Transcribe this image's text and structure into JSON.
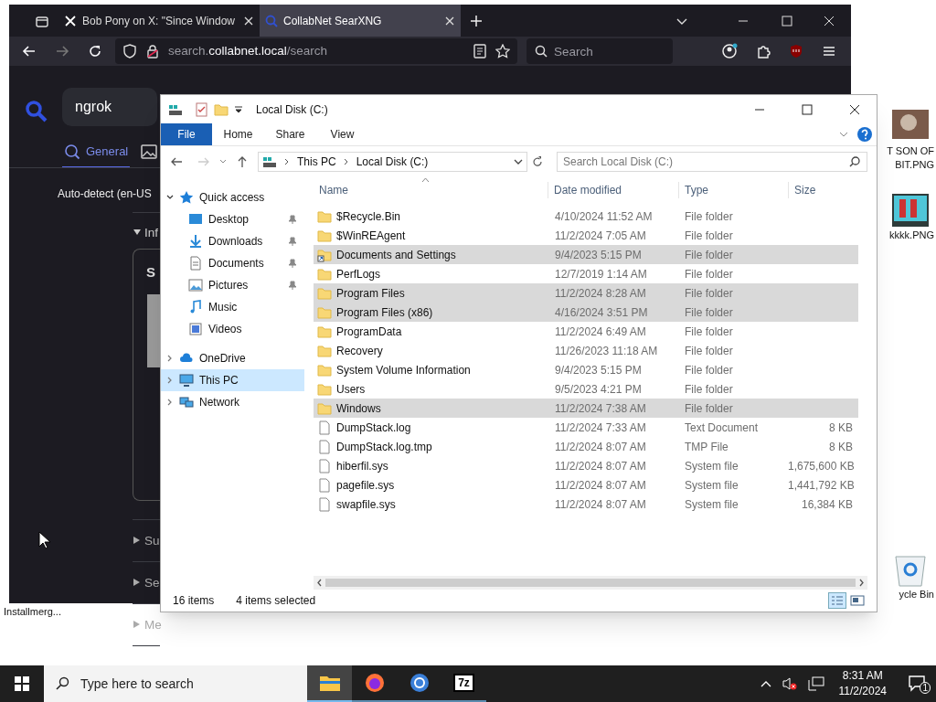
{
  "desktop": {
    "icons": [
      {
        "kind": "photo",
        "label_lines": [
          "T SON OF",
          "BIT.PNG"
        ]
      },
      {
        "kind": "image",
        "label_lines": [
          "kkkk.PNG"
        ]
      },
      {
        "kind": "recycle",
        "label_lines": [
          "ycle Bin"
        ]
      }
    ],
    "left_label": "Installmerg..."
  },
  "browser": {
    "tabs": [
      {
        "label": "Bob Pony on X: \"Since Window",
        "selected": false,
        "kind": "x"
      },
      {
        "label": "CollabNet SearXNG",
        "selected": true,
        "kind": "searx"
      }
    ],
    "url": {
      "subdomain": "search.",
      "domain": "collabnet.local",
      "path": "/search"
    },
    "search": {
      "placeholder": "Search"
    },
    "page": {
      "query": "ngrok",
      "categories": [
        {
          "label": "General",
          "selected": true,
          "kind": "search"
        },
        {
          "selected": false,
          "kind": "image"
        }
      ],
      "language": "Auto-detect (en-US",
      "infobox": {
        "toggle": "Inf",
        "heading": "S"
      },
      "sections": [
        "Su",
        "Se",
        "Me"
      ]
    }
  },
  "explorer": {
    "title": "Local Disk (C:)",
    "ribbon_tabs": [
      {
        "label": "File",
        "selected": true
      },
      {
        "label": "Home",
        "selected": false
      },
      {
        "label": "Share",
        "selected": false
      },
      {
        "label": "View",
        "selected": false
      }
    ],
    "breadcrumb": [
      "This PC",
      "Local Disk (C:)"
    ],
    "search": {
      "placeholder": "Search Local Disk (C:)"
    },
    "nav": [
      {
        "label": "Quick access",
        "kind": "star",
        "expanded": true,
        "selected": false,
        "children": [
          {
            "label": "Desktop",
            "kind": "desktop",
            "pinned": true
          },
          {
            "label": "Downloads",
            "kind": "download",
            "pinned": true
          },
          {
            "label": "Documents",
            "kind": "documents",
            "pinned": true
          },
          {
            "label": "Pictures",
            "kind": "pictures",
            "pinned": true
          },
          {
            "label": "Music",
            "kind": "music",
            "pinned": false
          },
          {
            "label": "Videos",
            "kind": "videos",
            "pinned": false
          }
        ]
      },
      {
        "label": "OneDrive",
        "kind": "cloud",
        "expanded": false,
        "selected": false
      },
      {
        "label": "This PC",
        "kind": "pc",
        "expanded": false,
        "selected": true
      },
      {
        "label": "Network",
        "kind": "network",
        "expanded": false,
        "selected": false
      }
    ],
    "columns": [
      "Name",
      "Date modified",
      "Type",
      "Size"
    ],
    "rows": [
      {
        "kind": "folder",
        "name": "$Recycle.Bin",
        "date": "4/10/2024 11:52 AM",
        "type": "File folder",
        "selected": false
      },
      {
        "kind": "folder",
        "name": "$WinREAgent",
        "date": "11/2/2024 7:05 AM",
        "type": "File folder",
        "selected": false
      },
      {
        "kind": "shortcut",
        "name": "Documents and Settings",
        "date": "9/4/2023 5:15 PM",
        "type": "File folder",
        "selected": true
      },
      {
        "kind": "folder",
        "name": "PerfLogs",
        "date": "12/7/2019 1:14 AM",
        "type": "File folder",
        "selected": false
      },
      {
        "kind": "folder",
        "name": "Program Files",
        "date": "11/2/2024 8:28 AM",
        "type": "File folder",
        "selected": true
      },
      {
        "kind": "folder",
        "name": "Program Files (x86)",
        "date": "4/16/2024 3:51 PM",
        "type": "File folder",
        "selected": true
      },
      {
        "kind": "folder",
        "name": "ProgramData",
        "date": "11/2/2024 6:49 AM",
        "type": "File folder",
        "selected": false
      },
      {
        "kind": "folder",
        "name": "Recovery",
        "date": "11/26/2023 11:18 AM",
        "type": "File folder",
        "selected": false
      },
      {
        "kind": "folder",
        "name": "System Volume Information",
        "date": "9/4/2023 5:15 PM",
        "type": "File folder",
        "selected": false
      },
      {
        "kind": "folder",
        "name": "Users",
        "date": "9/5/2023 4:21 PM",
        "type": "File folder",
        "selected": false
      },
      {
        "kind": "folder",
        "name": "Windows",
        "date": "11/2/2024 7:38 AM",
        "type": "File folder",
        "selected": true
      },
      {
        "kind": "file",
        "name": "DumpStack.log",
        "date": "11/2/2024 7:33 AM",
        "type": "Text Document",
        "size": "8 KB",
        "selected": false
      },
      {
        "kind": "file",
        "name": "DumpStack.log.tmp",
        "date": "11/2/2024 8:07 AM",
        "type": "TMP File",
        "size": "8 KB",
        "selected": false
      },
      {
        "kind": "file",
        "name": "hiberfil.sys",
        "date": "11/2/2024 8:07 AM",
        "type": "System file",
        "size": "1,675,600 KB",
        "selected": false
      },
      {
        "kind": "file",
        "name": "pagefile.sys",
        "date": "11/2/2024 8:07 AM",
        "type": "System file",
        "size": "1,441,792 KB",
        "selected": false
      },
      {
        "kind": "file",
        "name": "swapfile.sys",
        "date": "11/2/2024 8:07 AM",
        "type": "System file",
        "size": "16,384 KB",
        "selected": false
      }
    ],
    "status": {
      "count": "16 items",
      "selection": "4 items selected"
    }
  },
  "taskbar": {
    "search": {
      "placeholder": "Type here to search"
    },
    "apps": [
      {
        "kind": "explorer",
        "active": true
      },
      {
        "kind": "firefox",
        "active": false
      },
      {
        "kind": "chrome",
        "active": false
      },
      {
        "kind": "sevenzip",
        "label": "7z",
        "active": false
      }
    ],
    "time": "8:31 AM",
    "date": "11/2/2024",
    "notifications": "1"
  }
}
